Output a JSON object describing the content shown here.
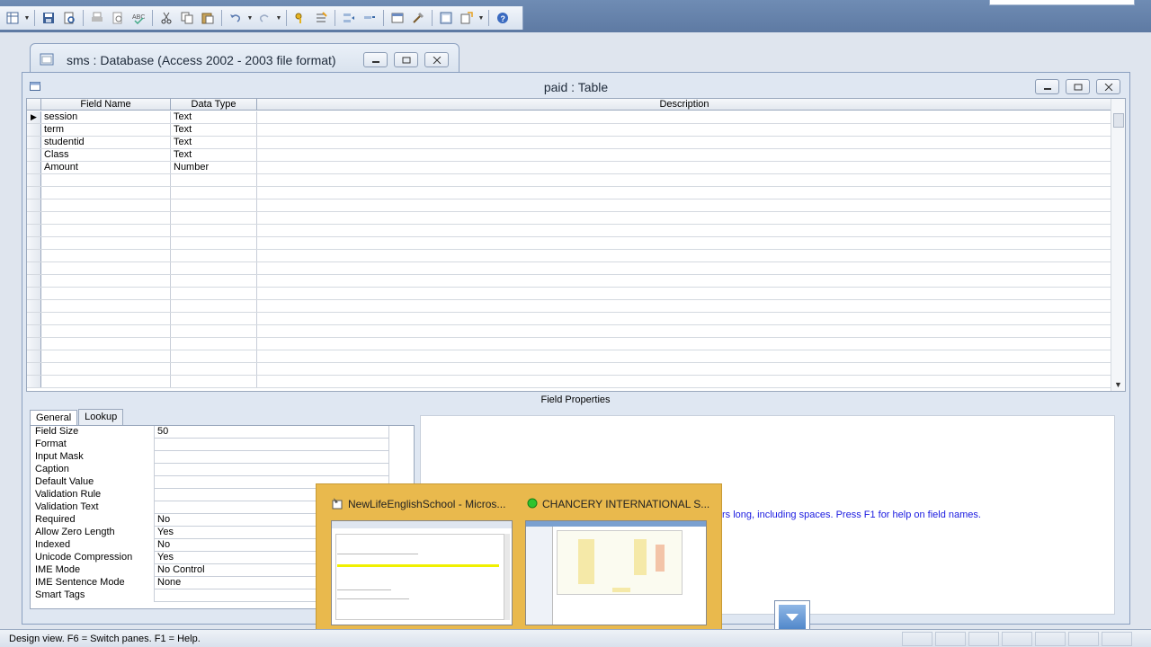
{
  "database_window": {
    "title": "sms : Database (Access 2002 - 2003 file format)"
  },
  "table_window": {
    "title": "paid : Table"
  },
  "grid": {
    "headers": [
      "Field Name",
      "Data Type",
      "Description"
    ],
    "rows": [
      {
        "field": "session",
        "type": "Text"
      },
      {
        "field": "term",
        "type": "Text"
      },
      {
        "field": "studentid",
        "type": "Text"
      },
      {
        "field": "Class",
        "type": "Text"
      },
      {
        "field": "Amount",
        "type": "Number"
      }
    ],
    "current_row_marker": "▶"
  },
  "field_properties": {
    "label": "Field Properties",
    "tabs": [
      "General",
      "Lookup"
    ],
    "active_tab": "General",
    "properties": [
      {
        "label": "Field Size",
        "value": "50"
      },
      {
        "label": "Format",
        "value": ""
      },
      {
        "label": "Input Mask",
        "value": ""
      },
      {
        "label": "Caption",
        "value": ""
      },
      {
        "label": "Default Value",
        "value": ""
      },
      {
        "label": "Validation Rule",
        "value": ""
      },
      {
        "label": "Validation Text",
        "value": ""
      },
      {
        "label": "Required",
        "value": "No"
      },
      {
        "label": "Allow Zero Length",
        "value": "Yes"
      },
      {
        "label": "Indexed",
        "value": "No"
      },
      {
        "label": "Unicode Compression",
        "value": "Yes"
      },
      {
        "label": "IME Mode",
        "value": "No Control"
      },
      {
        "label": "IME Sentence Mode",
        "value": "None"
      },
      {
        "label": "Smart Tags",
        "value": ""
      }
    ],
    "help_text": "rs long, including spaces.  Press F1 for help on field names."
  },
  "taskbar_preview": {
    "items": [
      {
        "title": "NewLifeEnglishSchool - Micros...",
        "icon": "vb-app-icon"
      },
      {
        "title": "CHANCERY INTERNATIONAL S...",
        "icon": "green-status-icon"
      }
    ]
  },
  "statusbar": {
    "text": "Design view.  F6 = Switch panes.  F1 = Help."
  },
  "colors": {
    "accent": "#5e7aa3",
    "preview_bg": "#e9b94d",
    "help_text": "#1a1ae0"
  }
}
